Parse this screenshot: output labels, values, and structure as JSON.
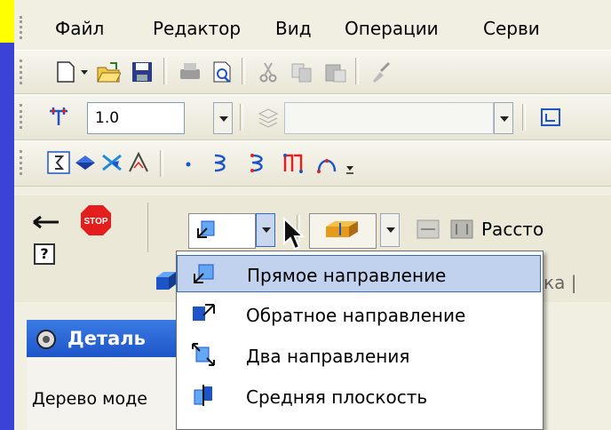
{
  "menu": {
    "items": [
      "Файл",
      "Редактор",
      "Вид",
      "Операции",
      "Серви"
    ]
  },
  "toolbar": {
    "scale_value": "1.0"
  },
  "panel": {
    "stop_label": "STOP",
    "help_label": "?",
    "distance_label": "Рассто",
    "partial_tab_text": "ка |"
  },
  "popup": {
    "items": [
      {
        "label": "Прямое направление",
        "icon": "forward-direction-icon"
      },
      {
        "label": "Обратное направление",
        "icon": "reverse-direction-icon"
      },
      {
        "label": "Два направления",
        "icon": "two-directions-icon"
      },
      {
        "label": "Средняя плоскость",
        "icon": "middle-plane-icon"
      }
    ]
  },
  "tree": {
    "title": "Деталь",
    "tab_label": "Дерево моде"
  },
  "colors": {
    "background": "#3a43d6",
    "title_bar": "#ffff00",
    "selection": "#c1d2ee",
    "tree_title": "#1d55c9"
  }
}
